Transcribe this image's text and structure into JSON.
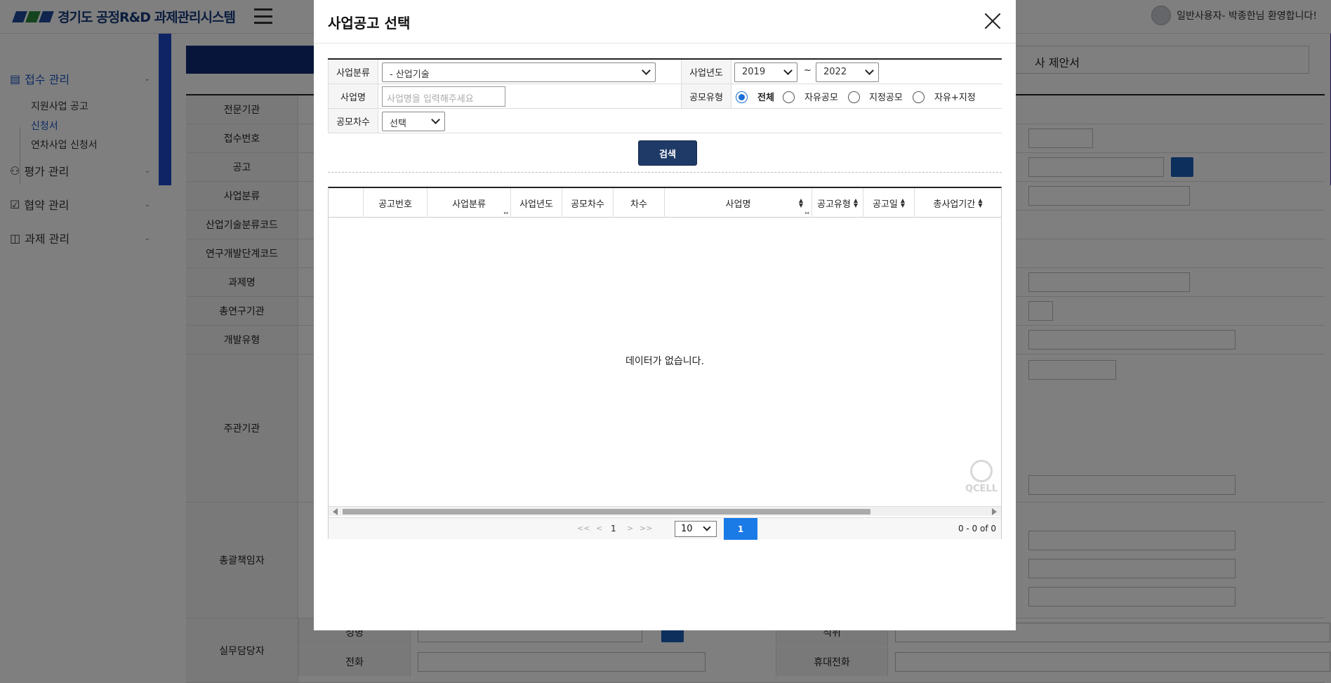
{
  "app": {
    "title": "경기도 공정R&D 과제관리시스템",
    "user_greeting": "일반사용자- 박종한님 환영합니다!"
  },
  "sidebar": {
    "groups": [
      {
        "label": "접수 관리",
        "icon": "document-icon"
      },
      {
        "label": "평가 관리",
        "icon": "people-icon"
      },
      {
        "label": "협약 관리",
        "icon": "checkbox-icon"
      },
      {
        "label": "과제 관리",
        "icon": "presentation-icon"
      }
    ],
    "sub_items": [
      "지원사업 공고",
      "신청서",
      "연차사업 신청서"
    ]
  },
  "background_form": {
    "tab_right": "사 제안서",
    "labels": [
      "전문기관",
      "접수번호",
      "공고",
      "사업분류",
      "산업기술분류코드",
      "연구개발단계코드",
      "과제명",
      "총연구기관",
      "개발유형",
      "주관기관",
      "총괄책임자",
      "실무담당자"
    ],
    "bottom_labels": {
      "name": "성명",
      "phone": "전화",
      "position": "직위",
      "mobile": "휴대전화"
    }
  },
  "modal": {
    "title": "사업공고 선택",
    "filters": {
      "category_label": "사업분류",
      "category_value": "- 산업기술",
      "year_label": "사업년도",
      "year_from": "2019",
      "year_sep": "~",
      "year_to": "2022",
      "name_label": "사업명",
      "name_placeholder": "사업명을 입력해주세요",
      "type_label": "공모유형",
      "type_options": [
        "전체",
        "자유공모",
        "지정공모",
        "자유+지정"
      ],
      "type_selected": "전체",
      "round_label": "공모차수",
      "round_value": "선택"
    },
    "search_button": "검색",
    "grid": {
      "columns": [
        "공고번호",
        "사업분류",
        "사업년도",
        "공모차수",
        "차수",
        "사업명",
        "공고유형",
        "공고일",
        "총사업기간"
      ],
      "empty_message": "데이터가 없습니다.",
      "watermark": "QCELL"
    },
    "pager": {
      "first": "<<",
      "prev": "<",
      "page": "1",
      "next": ">",
      "last": ">>",
      "page_size": "10",
      "current": "1",
      "count": "0 - 0 of 0"
    }
  }
}
